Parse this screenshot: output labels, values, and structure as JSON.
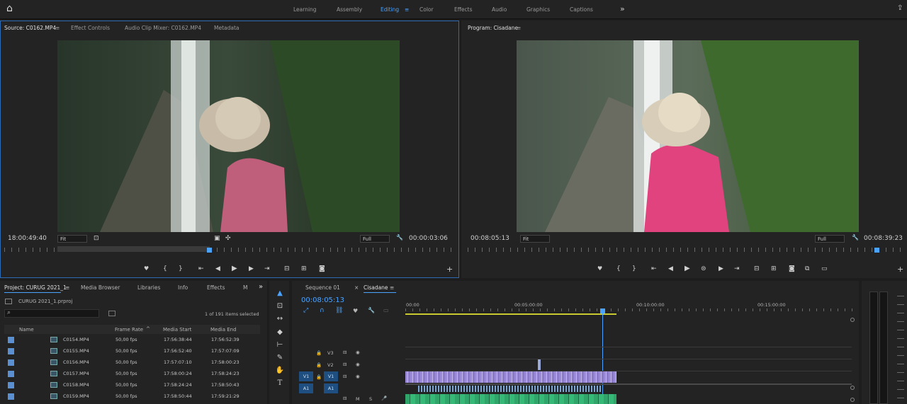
{
  "topbar": {
    "workspaces": [
      "Learning",
      "Assembly",
      "Editing",
      "Color",
      "Effects",
      "Audio",
      "Graphics",
      "Captions"
    ],
    "active": "Editing",
    "more": "»"
  },
  "source": {
    "tabs": [
      "Source: C0162.MP4",
      "Effect Controls",
      "Audio Clip Mixer: C0162.MP4",
      "Metadata"
    ],
    "menu": "≡",
    "timecode": "18:00:49:40",
    "fit": "Fit",
    "quality": "Full",
    "duration": "00:00:03:06"
  },
  "program": {
    "tab": "Program: Cisadane",
    "menu": "≡",
    "timecode": "00:08:05:13",
    "fit": "Fit",
    "quality": "Full",
    "duration": "00:08:39:23"
  },
  "project": {
    "tabs": [
      "Project: CURUG 2021_1",
      "Media Browser",
      "Libraries",
      "Info",
      "Effects",
      "M"
    ],
    "more": "»",
    "file": "CURUG 2021_1.prproj",
    "count": "1 of 191 items selected",
    "columns": [
      "Name",
      "Frame Rate",
      "Media Start",
      "Media End"
    ],
    "rows": [
      {
        "name": "C0154.MP4",
        "fps": "50,00 fps",
        "start": "17:56:38:44",
        "end": "17:56:52:39"
      },
      {
        "name": "C0155.MP4",
        "fps": "50,00 fps",
        "start": "17:56:52:40",
        "end": "17:57:07:09"
      },
      {
        "name": "C0156.MP4",
        "fps": "50,00 fps",
        "start": "17:57:07:10",
        "end": "17:58:00:23"
      },
      {
        "name": "C0157.MP4",
        "fps": "50,00 fps",
        "start": "17:58:00:24",
        "end": "17:58:24:23"
      },
      {
        "name": "C0158.MP4",
        "fps": "50,00 fps",
        "start": "17:58:24:24",
        "end": "17:58:50:43"
      },
      {
        "name": "C0159.MP4",
        "fps": "50,00 fps",
        "start": "17:58:50:44",
        "end": "17:59:21:29"
      }
    ]
  },
  "timeline": {
    "tabs": [
      "Sequence 01",
      "Cisadane"
    ],
    "menu": "≡",
    "timecode": "00:08:05:13",
    "ruler": [
      "00:00",
      "00:05:00:00",
      "00:10:00:00",
      "00:15:00:00"
    ],
    "tracks": {
      "v3": "V3",
      "v2": "V2",
      "v1": "V1",
      "a1": "A1",
      "m": "M",
      "s": "S"
    }
  },
  "icons": {
    "home": "⌂",
    "export": "⇪",
    "marker": "♥",
    "in": "{",
    "out": "}",
    "play": "▶",
    "stepback": "◀",
    "stepfwd": "▶",
    "gotoin": "⇤",
    "gotoout": "⇥",
    "camera": "◙",
    "plus": "+",
    "wrench": "🔧",
    "search": "⌕",
    "eye": "👁",
    "lock": "🔒",
    "selection": "▲",
    "track": "⊡",
    "ripple": "↔",
    "razor": "◆",
    "slip": "⊢",
    "pen": "✎",
    "hand": "✋",
    "type": "T"
  }
}
